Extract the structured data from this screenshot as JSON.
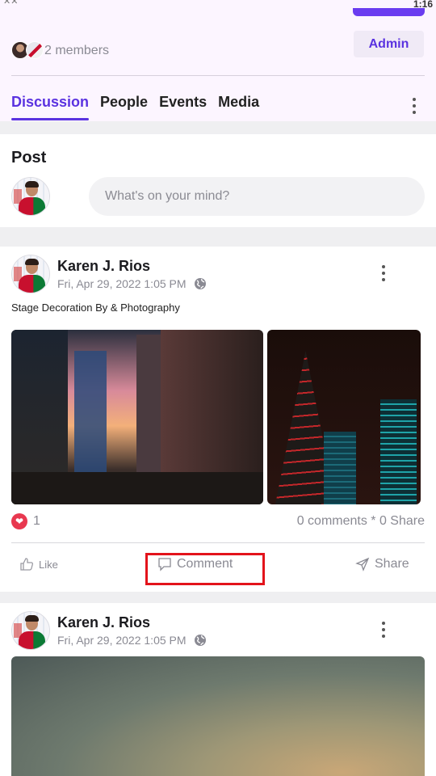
{
  "status": {
    "time": "1:16",
    "signal_icon": "signal-icon"
  },
  "group": {
    "members_text": "2 members",
    "admin_label": "Admin",
    "tabs": [
      {
        "label": "Discussion",
        "active": true
      },
      {
        "label": "People",
        "active": false
      },
      {
        "label": "Events",
        "active": false
      },
      {
        "label": "Media",
        "active": false
      }
    ]
  },
  "post_box": {
    "title": "Post",
    "placeholder": "What's on your mind?"
  },
  "feed": [
    {
      "author": "Karen J. Rios",
      "timestamp": "Fri, Apr 29, 2022 1:05 PM",
      "caption": "Stage Decoration By & Photography",
      "reaction_count": "1",
      "stats": "0 comments * 0 Share",
      "actions": {
        "like": "Like",
        "comment": "Comment",
        "share": "Share"
      }
    },
    {
      "author": "Karen J. Rios",
      "timestamp": "Fri, Apr 29, 2022 1:05 PM"
    }
  ],
  "colors": {
    "accent": "#5a32e0",
    "heart": "#e8384f",
    "highlight": "#e3131b"
  }
}
